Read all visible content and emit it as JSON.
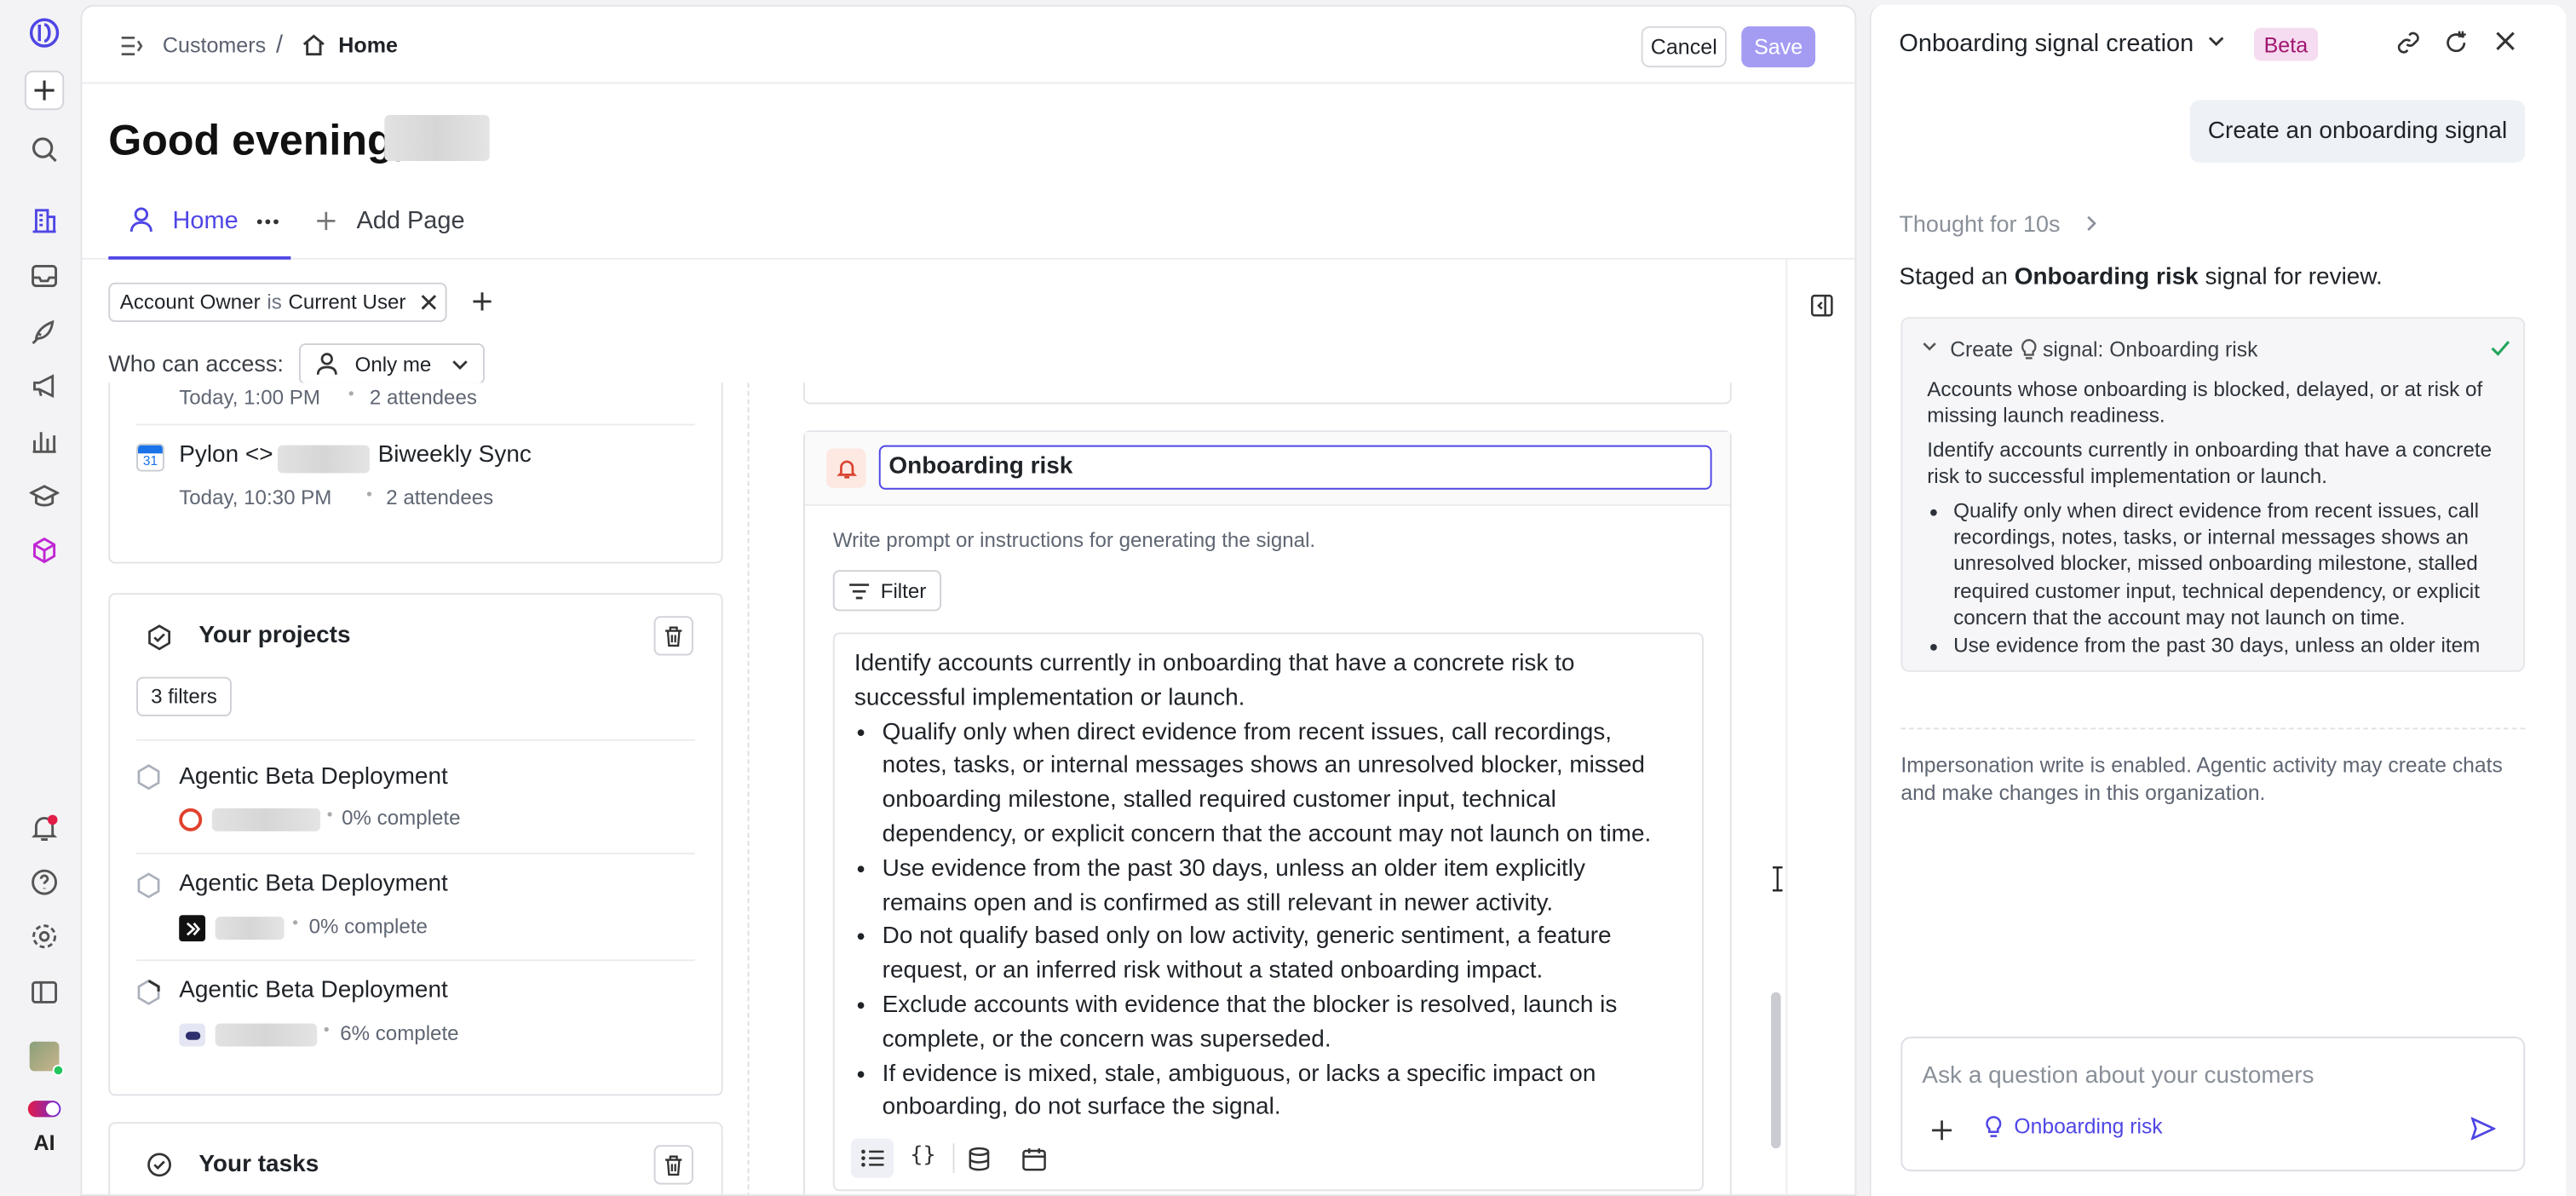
{
  "breadcrumb": {
    "parent": "Customers",
    "separator": "/",
    "current": "Home"
  },
  "actions": {
    "cancel": "Cancel",
    "save": "Save"
  },
  "greeting": "Good evening,",
  "tabs": {
    "home": "Home",
    "add_page": "Add Page"
  },
  "filter_chip": {
    "field": "Account Owner",
    "op": "is",
    "value": "Current User"
  },
  "access": {
    "label": "Who can access:",
    "value": "Only me"
  },
  "meetings": [
    {
      "time": "Today, 1:00 PM",
      "attendees": "2 attendees"
    },
    {
      "title_prefix": "Pylon <>",
      "title_suffix": "Biweekly Sync",
      "time": "Today, 10:30 PM",
      "attendees": "2 attendees"
    }
  ],
  "projects": {
    "title": "Your projects",
    "filters": "3 filters",
    "items": [
      {
        "title": "Agentic Beta Deployment",
        "progress": "0% complete"
      },
      {
        "title": "Agentic Beta Deployment",
        "progress": "0% complete"
      },
      {
        "title": "Agentic Beta Deployment",
        "progress": "6% complete"
      }
    ]
  },
  "tasks": {
    "title": "Your tasks"
  },
  "signal_editor": {
    "name": "Onboarding risk",
    "hint": "Write prompt or instructions for generating the signal.",
    "filter_label": "Filter",
    "prompt_intro": "Identify accounts currently in onboarding that have a concrete risk to successful implementation or launch.",
    "prompt_bullets": [
      "Qualify only when direct evidence from recent issues, call recordings, notes, tasks, or internal messages shows an unresolved blocker, missed onboarding milestone, stalled required customer input, technical dependency, or explicit concern that the account may not launch on time.",
      "Use evidence from the past 30 days, unless an older item explicitly remains open and is confirmed as still relevant in newer activity.",
      "Do not qualify based only on low activity, generic sentiment, a feature request, or an inferred risk without a stated onboarding impact.",
      "Exclude accounts with evidence that the blocker is resolved, launch is complete, or the concern was superseded.",
      "If evidence is mixed, stale, ambiguous, or lacks a specific impact on onboarding, do not surface the signal."
    ]
  },
  "ai_panel": {
    "title": "Onboarding signal creation",
    "badge": "Beta",
    "user_message": "Create an onboarding signal",
    "thought": "Thought for 10s",
    "staged_prefix": "Staged an",
    "staged_bold": "Onboarding risk",
    "staged_suffix": "signal for review.",
    "step_prefix": "Create",
    "step_suffix": "signal: Onboarding risk",
    "step_desc": "Accounts whose onboarding is blocked, delayed, or at risk of missing launch readiness.",
    "step_intro": "Identify accounts currently in onboarding that have a concrete risk to successful implementation or launch.",
    "step_bullets": [
      "Qualify only when direct evidence from recent issues, call recordings, notes, tasks, or internal messages shows an unresolved blocker, missed onboarding milestone, stalled required customer input, technical dependency, or explicit concern that the account may not launch on time.",
      "Use evidence from the past 30 days, unless an older item"
    ],
    "notice": "Impersonation write is enabled. Agentic activity may create chats and make changes in this organization.",
    "input_placeholder": "Ask a question about your customers",
    "context_chip": "Onboarding risk"
  },
  "rail": {
    "ai_label": "AI"
  },
  "colors": {
    "accent": "#4f46e5",
    "save_disabled": "#a49cf3",
    "beta_bg": "#f6dcf0",
    "beta_text": "#a1166f",
    "success": "#22a55b"
  }
}
